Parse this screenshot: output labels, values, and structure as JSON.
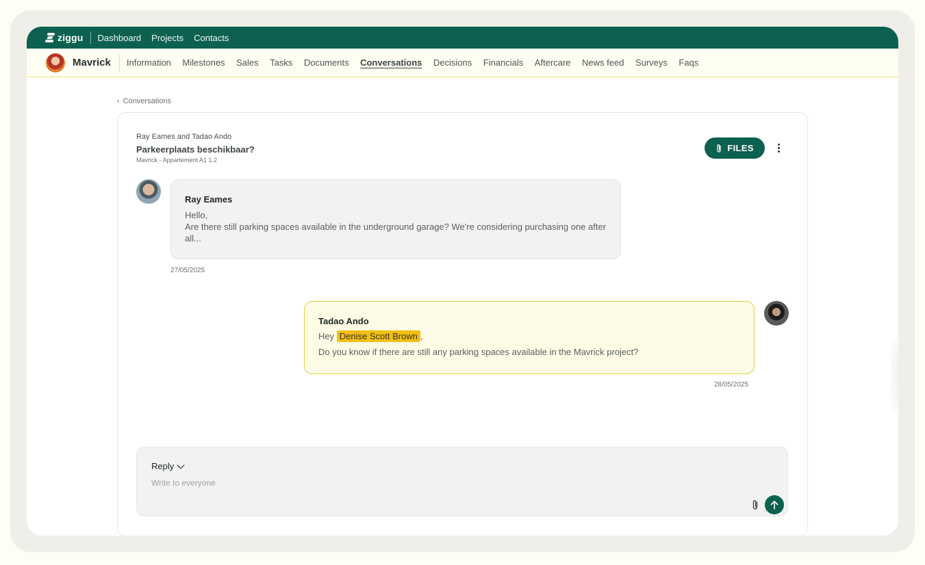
{
  "brand": {
    "name": "ziggu"
  },
  "topnav": {
    "items": [
      {
        "label": "Dashboard"
      },
      {
        "label": "Projects"
      },
      {
        "label": "Contacts"
      }
    ]
  },
  "project": {
    "name": "Mavrick",
    "tabs": [
      {
        "label": "Information"
      },
      {
        "label": "Milestones"
      },
      {
        "label": "Sales"
      },
      {
        "label": "Tasks"
      },
      {
        "label": "Documents"
      },
      {
        "label": "Conversations"
      },
      {
        "label": "Decisions"
      },
      {
        "label": "Financials"
      },
      {
        "label": "Aftercare"
      },
      {
        "label": "News feed"
      },
      {
        "label": "Surveys"
      },
      {
        "label": "Faqs"
      }
    ],
    "active_tab": "Conversations"
  },
  "breadcrumb": {
    "label": "Conversations"
  },
  "conversation": {
    "participants": "Ray Eames and Tadao Ando",
    "title": "Parkeerplaats beschikbaar?",
    "subtitle": "Mavrick - Appartement A1 1.2",
    "files_label": "FILES",
    "messages": [
      {
        "author": "Ray Eames",
        "line1": "Hello,",
        "line2": "Are there still parking spaces available in the underground garage? We're considering purchasing one after all...",
        "date": "27/05/2025"
      },
      {
        "author": "Tadao Ando",
        "greeting": "Hey",
        "mention": "Denise Scott Brown",
        "after_mention": ",",
        "line2": "Do you know if there are still any parking spaces available in the Mavrick project?",
        "date": "28/05/2025"
      }
    ]
  },
  "reply": {
    "label": "Reply",
    "placeholder": "Write to everyone"
  },
  "colors": {
    "brand_green": "#0c6150",
    "mention_yellow": "#f2bf12",
    "outgoing_bubble": "#fefbe6",
    "outgoing_border": "#e2cd3c"
  }
}
